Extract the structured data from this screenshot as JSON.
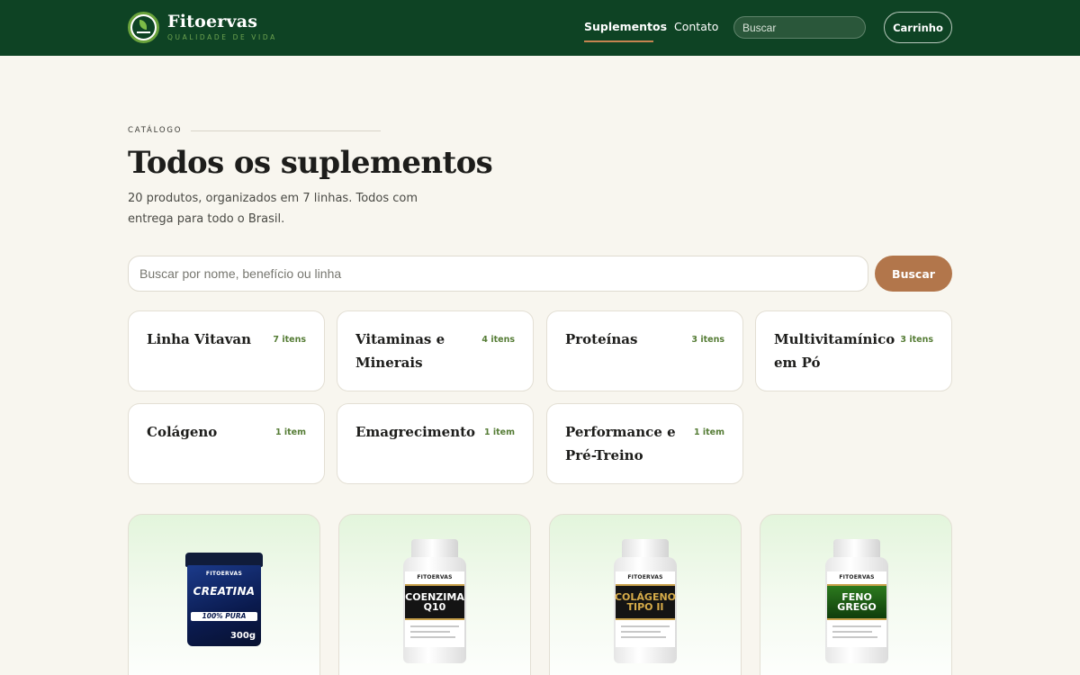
{
  "header": {
    "brand_name": "Fitoervas",
    "brand_tagline": "QUALIDADE DE VIDA",
    "nav": [
      {
        "label": "Suplementos",
        "active": true
      },
      {
        "label": "Contato",
        "active": false
      }
    ],
    "search_placeholder": "Buscar",
    "cart_label": "Carrinho",
    "bg_color": "#0e4324"
  },
  "intro": {
    "eyebrow": "CATÁLOGO",
    "title": "Todos os suplementos",
    "description": "20 produtos, organizados em 7 linhas. Todos com entrega para todo o Brasil."
  },
  "search": {
    "placeholder": "Buscar por nome, benefício ou linha",
    "button_label": "Buscar",
    "button_color": "#b2764b"
  },
  "categories": [
    {
      "name": "Linha Vitavan",
      "count": "7 itens"
    },
    {
      "name": "Vitaminas e Minerais",
      "count": "4 itens"
    },
    {
      "name": "Proteínas",
      "count": "3 itens"
    },
    {
      "name": "Multivitamínico em Pó",
      "count": "3 itens"
    },
    {
      "name": "Colágeno",
      "count": "1 item"
    },
    {
      "name": "Emagrecimento",
      "count": "1 item"
    },
    {
      "name": "Performance e Pré-Treino",
      "count": "1 item"
    }
  ],
  "products": [
    {
      "brand": "FITOERVAS",
      "label": "CREATINA",
      "sub": "100% PURA",
      "weight": "300g"
    },
    {
      "brand": "FITOERVAS",
      "label": "COENZIMA Q10"
    },
    {
      "brand": "FITOERVAS",
      "label": "COLÁGENO TIPO II"
    },
    {
      "brand": "FITOERVAS",
      "label": "FENO GREGO"
    }
  ]
}
